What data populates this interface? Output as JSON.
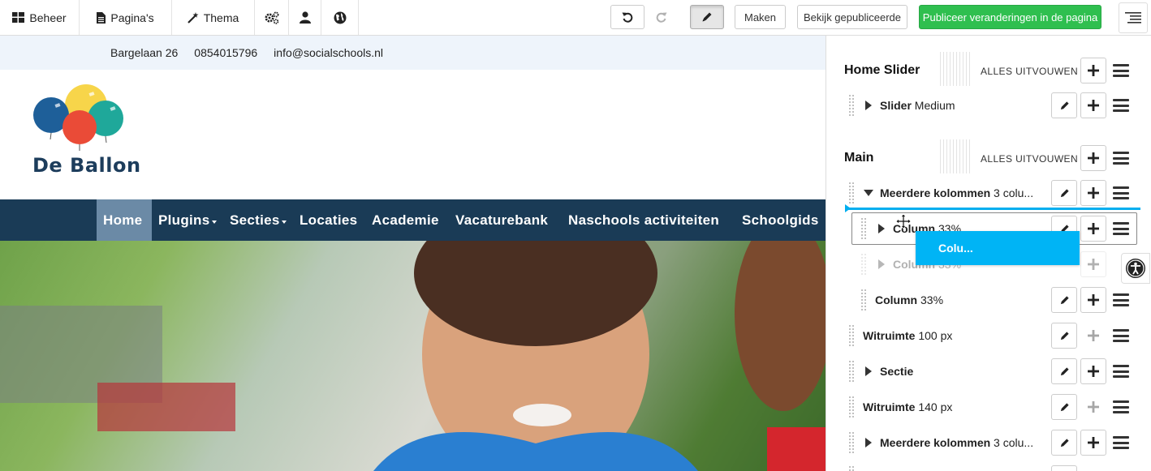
{
  "toolbar": {
    "beheer": "Beheer",
    "paginas": "Pagina's",
    "thema": "Thema",
    "maken": "Maken",
    "bekijk": "Bekijk gepubliceerde",
    "publiceer": "Publiceer veranderingen in de pagina",
    "colors": {
      "publish": "#2fbf4f"
    }
  },
  "site": {
    "address": "Bargelaan 26",
    "phone": "0854015796",
    "email": "info@socialschools.nl",
    "logo_text": "De Ballon",
    "nav": [
      {
        "label": "Home",
        "active": true
      },
      {
        "label": "Plugins",
        "dropdown": true
      },
      {
        "label": "Secties",
        "dropdown": true
      },
      {
        "label": "Locaties"
      },
      {
        "label": "Academie"
      },
      {
        "label": "Vacaturebank"
      },
      {
        "label": "Naschools activiteiten"
      },
      {
        "label": "Schoolgids"
      }
    ],
    "colors": {
      "nav_bg": "#1a3b56",
      "nav_active": "#6b8aa6",
      "contact_bg": "#eef4fb"
    }
  },
  "panel": {
    "home_slider": {
      "title": "Home Slider",
      "expand_all": "ALLES UITVOUWEN",
      "items": [
        {
          "bold": "Slider",
          "rest": " Medium"
        }
      ]
    },
    "main": {
      "title": "Main",
      "expand_all": "ALLES UITVOUWEN",
      "items": [
        {
          "bold": "Meerdere kolommen",
          "rest": " 3 colu..."
        },
        {
          "bold": "Column",
          "rest": " 33%"
        },
        {
          "bold": "Column",
          "rest": " 33%"
        },
        {
          "bold": "Column",
          "rest": " 33%"
        },
        {
          "bold": "Witruimte",
          "rest": " 100 px"
        },
        {
          "bold": "Sectie",
          "rest": ""
        },
        {
          "bold": "Witruimte",
          "rest": " 140 px"
        },
        {
          "bold": "Meerdere kolommen",
          "rest": " 3 colu..."
        }
      ]
    },
    "drag_ghost": "Colu...",
    "colors": {
      "drop_indicator": "#00aeef"
    }
  }
}
